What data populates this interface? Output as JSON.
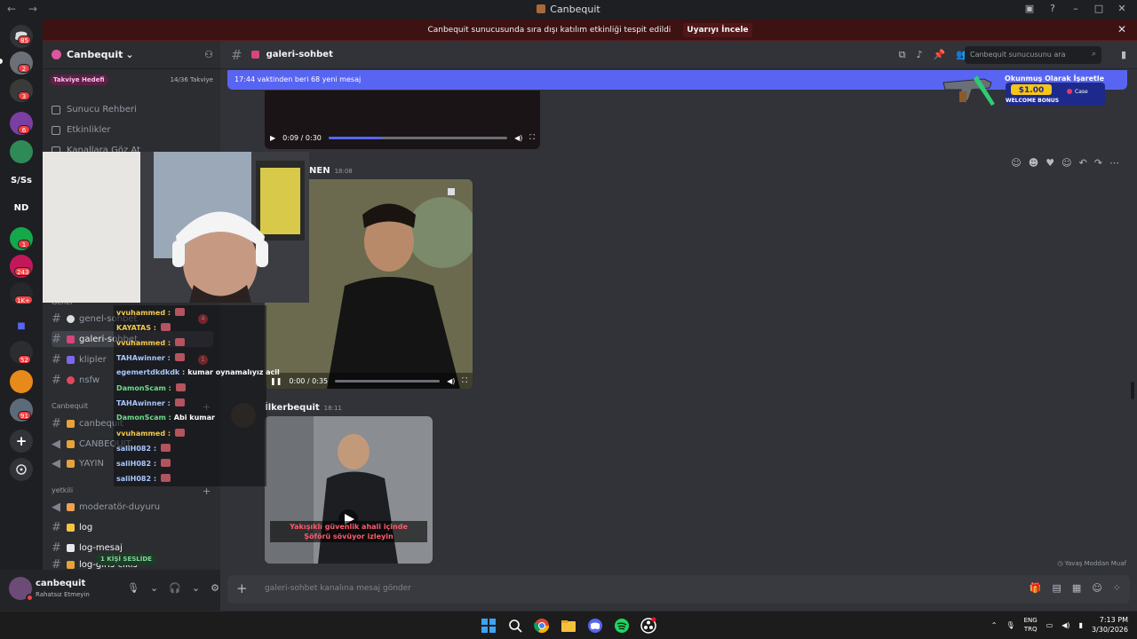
{
  "window": {
    "title": "Canbequit",
    "nav_back": "←",
    "nav_fwd": "→"
  },
  "guilds": {
    "badges": [
      "85",
      "2",
      "3",
      "6",
      "1",
      "243",
      "1K+",
      "52",
      "91"
    ],
    "text_icons": [
      "S/Ss",
      "ND"
    ]
  },
  "banner": {
    "text": "Canbequit sunucusunda sıra dışı katılım etkinliği tespit edildi",
    "button": "Uyarıyı İncele",
    "close": "✕"
  },
  "server": {
    "name": "Canbequit",
    "chevron": "⌄"
  },
  "boost": {
    "label": "Takviye Hedefi",
    "progress": "14/36 Takviye",
    "progress_fraction": 0.389
  },
  "nav_items": [
    "Sunucu Rehberi",
    "Etkinlikler",
    "Kanallara Göz At"
  ],
  "categories": {
    "general": "Genel",
    "canbequit": "Canbequit",
    "yetkili": "yetkili"
  },
  "channels_general": [
    {
      "name": "genel-sohbet",
      "badge": "4"
    },
    {
      "name": "galeri-sohbet"
    },
    {
      "name": "klipler",
      "badge": "1"
    },
    {
      "name": "nsfw"
    }
  ],
  "channels_canbequit": [
    "canbequit",
    "CANBEQUIT",
    "YAYIN"
  ],
  "channels_yetkili": [
    "moderatör-duyuru",
    "log",
    "log-mesaj",
    "log-giris-cikis"
  ],
  "voice_pill": "1 KİŞİ SESLİDE",
  "user": {
    "name": "canbequit",
    "status": "Rahatsız Etmeyin"
  },
  "channel_header": {
    "name": "galeri-sohbet",
    "search_placeholder": "Canbequit sunucusunu ara"
  },
  "new_messages": {
    "text": "17:44 vaktinden beri 68 yeni mesaj",
    "mark_read": "Okunmuş Olarak İşaretle"
  },
  "ad": {
    "amount": "$1.00",
    "line": "WELCOME BONUS",
    "brand": "Case"
  },
  "messages": [
    {
      "author": "",
      "time": "",
      "video_time": "0:09 / 0:30",
      "progress": 0.3
    },
    {
      "author": "NEN",
      "time": "18:08",
      "video_time": "0:00 / 0:35",
      "progress": 0.0
    },
    {
      "author": "İlkerbequit",
      "time": "18:11",
      "caption_1": "Yakışıklı güvenlik ahali içinde",
      "caption_2": "Şöförü sövüyor izleyin"
    }
  ],
  "stream_chat": [
    {
      "user": "vvuhammed :",
      "msg": "",
      "color": "#f2c94c"
    },
    {
      "user": "KAYATAS :",
      "msg": "",
      "color": "#f2c94c"
    },
    {
      "user": "vvuhammed :",
      "msg": "",
      "color": "#f2c94c"
    },
    {
      "user": "TAHAwinner :",
      "msg": "",
      "color": "#a8c7ff"
    },
    {
      "user": "egemertdkdkdk :",
      "msg": "kumar oynamalıyız acil",
      "color": "#a8c7ff"
    },
    {
      "user": "DamonScam :",
      "msg": "",
      "color": "#6fdc8c"
    },
    {
      "user": "TAHAwinner :",
      "msg": "",
      "color": "#a8c7ff"
    },
    {
      "user": "DamonScam :",
      "msg": "Abi kumar",
      "color": "#6fdc8c"
    },
    {
      "user": "vvuhammed :",
      "msg": "",
      "color": "#f2c94c"
    },
    {
      "user": "saliH082 :",
      "msg": "",
      "color": "#a8c7ff"
    },
    {
      "user": "saliH082 :",
      "msg": "",
      "color": "#a8c7ff"
    },
    {
      "user": "saliH082 :",
      "msg": "",
      "color": "#a8c7ff"
    }
  ],
  "composer": {
    "placeholder": "galeri-sohbet kanalına mesaj gönder"
  },
  "slowmode": "Yavaş Moddan Muaf",
  "taskbar": {
    "lang_1": "ENG",
    "lang_2": "TRQ",
    "time": "7:13 PM",
    "date": "3/30/2026"
  },
  "colors": {
    "accent": "#5865f2",
    "dnd": "#f23f43",
    "banner_bg": "#3d1212"
  }
}
